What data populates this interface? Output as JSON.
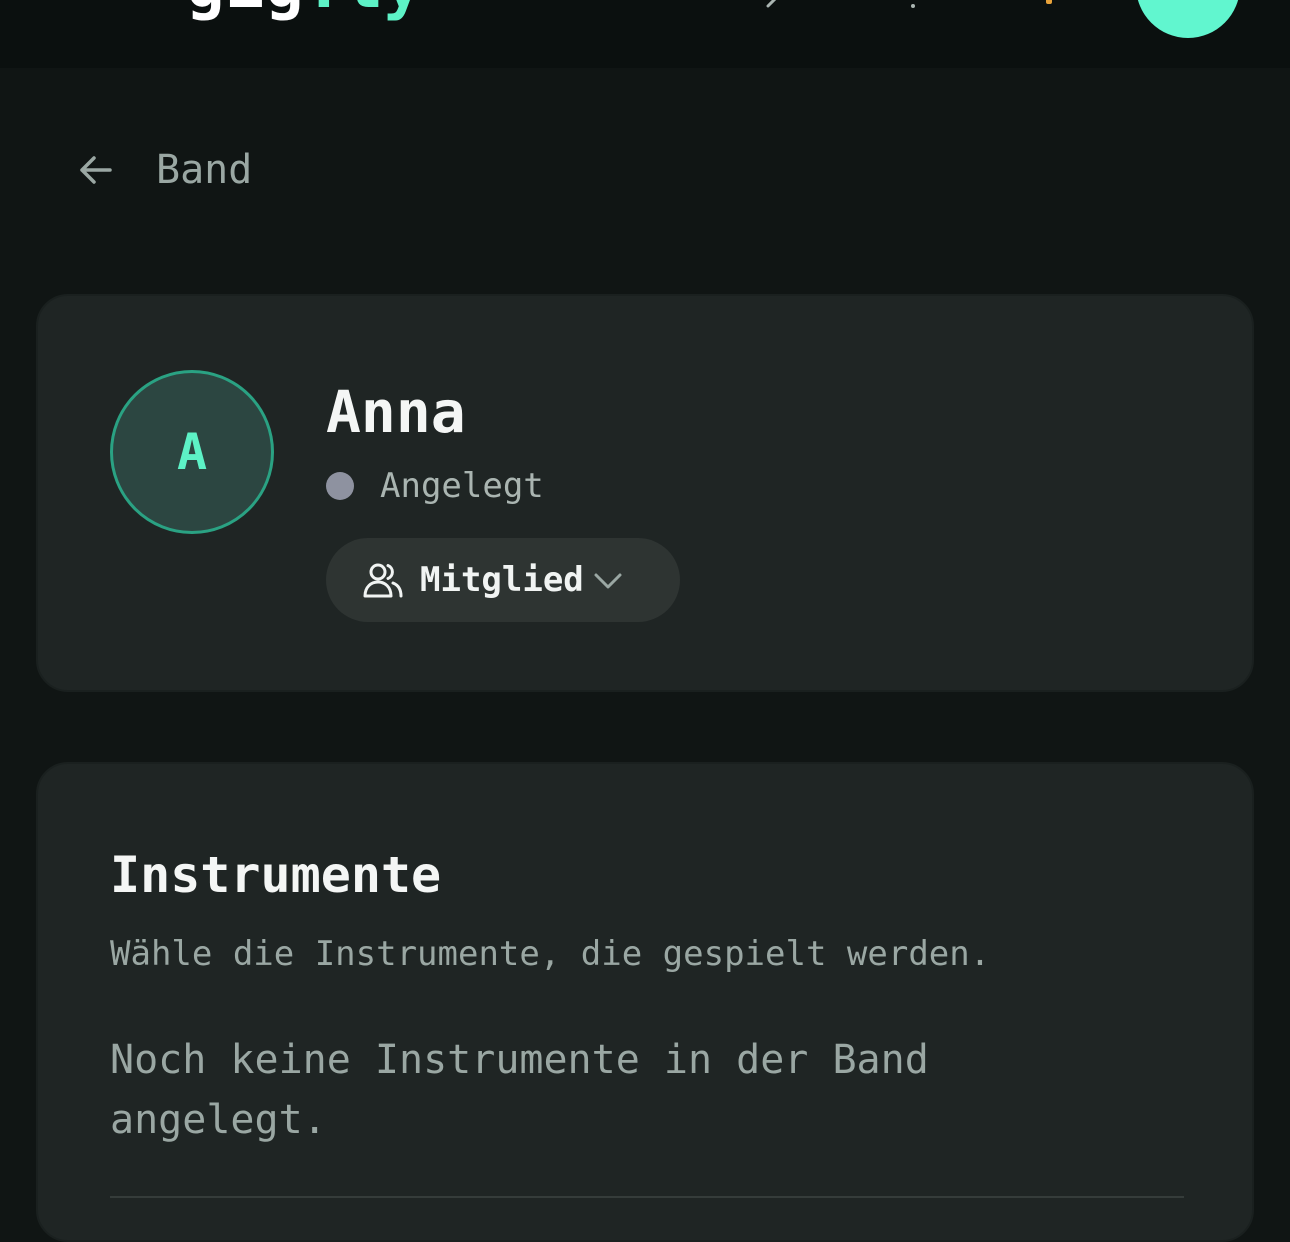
{
  "header": {
    "logo_primary": "gig",
    "logo_accent": ".ly",
    "brand_color": "#5df2c6"
  },
  "nav": {
    "back_label": "Band"
  },
  "member": {
    "avatar_initial": "A",
    "name": "Anna",
    "status_label": "Angelegt",
    "status_color": "#8e92a0",
    "role_label": "Mitglied"
  },
  "instruments": {
    "title": "Instrumente",
    "subtitle": "Wähle die Instrumente, die gespielt werden.",
    "empty_message": "Noch keine Instrumente in der Band angelegt."
  }
}
